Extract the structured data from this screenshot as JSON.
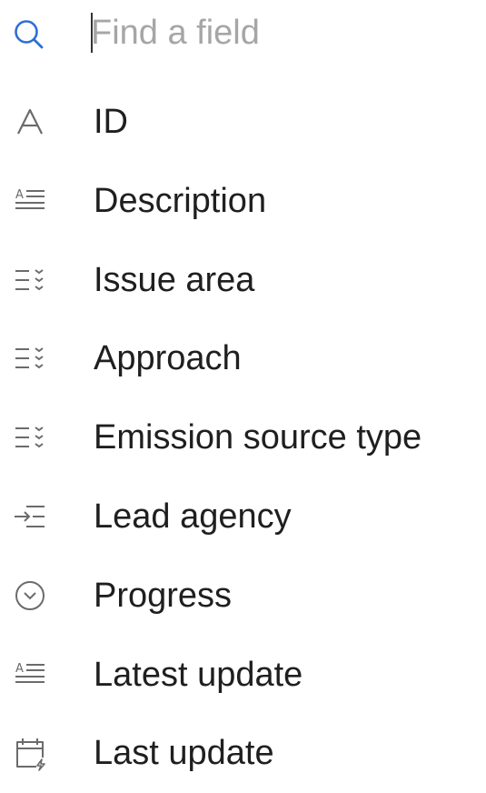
{
  "search": {
    "placeholder": "Find a field",
    "value": "",
    "icon": "search-icon"
  },
  "fields": [
    {
      "label": "ID",
      "icon": "text-type-icon"
    },
    {
      "label": "Description",
      "icon": "long-text-icon"
    },
    {
      "label": "Issue area",
      "icon": "multi-select-icon"
    },
    {
      "label": "Approach",
      "icon": "multi-select-icon"
    },
    {
      "label": "Emission source type",
      "icon": "multi-select-icon"
    },
    {
      "label": "Lead agency",
      "icon": "linked-record-icon"
    },
    {
      "label": "Progress",
      "icon": "single-select-icon"
    },
    {
      "label": "Latest update",
      "icon": "long-text-icon"
    },
    {
      "label": "Last update",
      "icon": "last-modified-date-icon"
    }
  ],
  "colors": {
    "accent": "#2d6fd6",
    "icon": "#6b6b6b",
    "text": "#1f1f1f",
    "placeholder": "#a6a6a6"
  }
}
